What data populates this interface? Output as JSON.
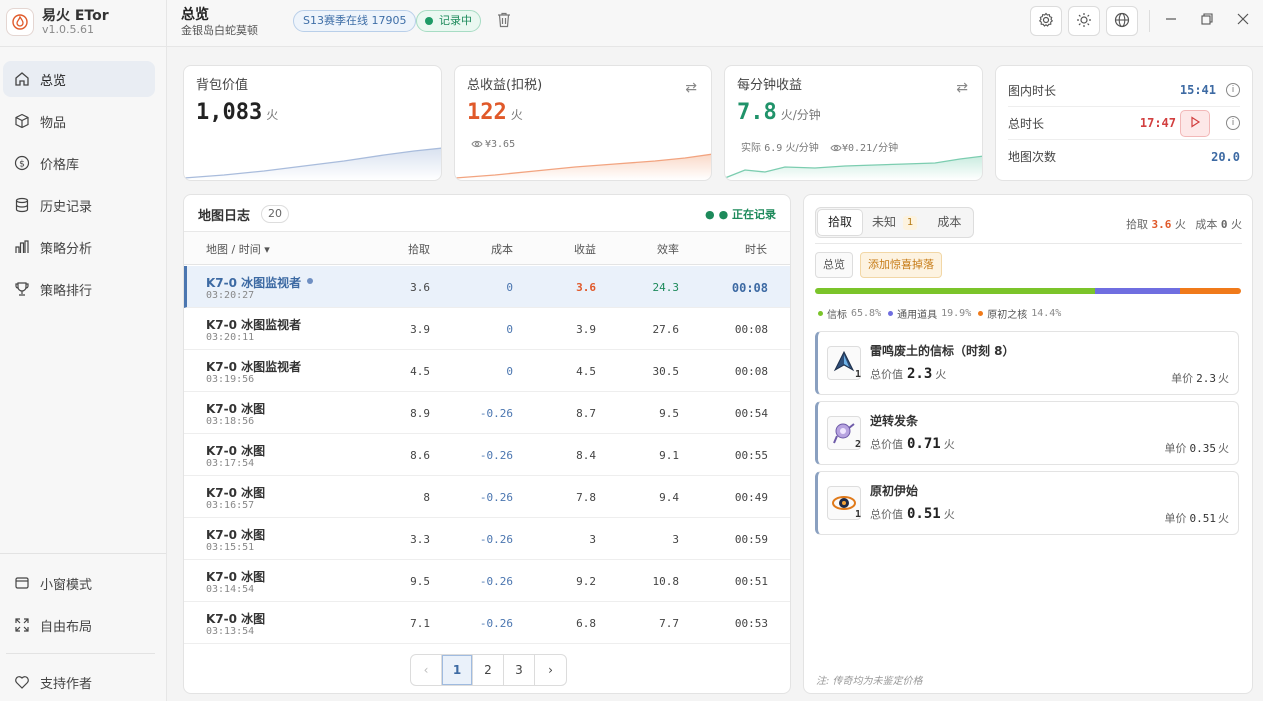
{
  "app": {
    "name": "易火 ETor",
    "version": "v1.0.5.61"
  },
  "sidebar": {
    "items": [
      {
        "label": "总览",
        "icon": "home-icon",
        "active": true
      },
      {
        "label": "物品",
        "icon": "cube-icon"
      },
      {
        "label": "价格库",
        "icon": "dollar-icon"
      },
      {
        "label": "历史记录",
        "icon": "database-icon"
      },
      {
        "label": "策略分析",
        "icon": "bar-chart-icon"
      },
      {
        "label": "策略排行",
        "icon": "trophy-icon"
      }
    ],
    "bottom": [
      {
        "label": "小窗模式",
        "icon": "window-icon"
      },
      {
        "label": "自由布局",
        "icon": "expand-icon"
      }
    ],
    "support": {
      "label": "支持作者",
      "icon": "heart-icon"
    }
  },
  "topbar": {
    "title": "总览",
    "subtitle": "金银岛白蛇莫顿",
    "season_badge": "S13赛季在线  17905",
    "recording_badge": "记录中"
  },
  "stats": {
    "backpack": {
      "label": "背包价值",
      "value": "1,083",
      "unit": "火"
    },
    "total_income": {
      "label": "总收益(扣税)",
      "value": "122",
      "unit": "火",
      "sub": "¥3.65"
    },
    "per_minute": {
      "label": "每分钟收益",
      "value": "7.8",
      "unit": "火/分钟",
      "actual_label": "实际",
      "actual_value": "6.9",
      "actual_unit": "火/分钟",
      "sub": "¥0.21/分钟"
    },
    "times": {
      "in_map_label": "图内时长",
      "in_map_value": "15:41",
      "total_label": "总时长",
      "total_value": "17:47",
      "count_label": "地图次数",
      "count_value": "20.0"
    }
  },
  "map_log": {
    "title": "地图日志",
    "count": "20",
    "live": "● 正在记录",
    "headers": {
      "name": "地图 / 时间 ▾",
      "pick": "拾取",
      "cost": "成本",
      "income": "收益",
      "eff": "效率",
      "dur": "时长"
    },
    "rows": [
      {
        "name": "K7-0 冰图监视者",
        "time": "03:20:27",
        "pick": "3.6",
        "cost": "0",
        "income": "3.6",
        "eff": "24.3",
        "dur": "00:08"
      },
      {
        "name": "K7-0 冰图监视者",
        "time": "03:20:11",
        "pick": "3.9",
        "cost": "0",
        "income": "3.9",
        "eff": "27.6",
        "dur": "00:08"
      },
      {
        "name": "K7-0 冰图监视者",
        "time": "03:19:56",
        "pick": "4.5",
        "cost": "0",
        "income": "4.5",
        "eff": "30.5",
        "dur": "00:08"
      },
      {
        "name": "K7-0 冰图",
        "time": "03:18:56",
        "pick": "8.9",
        "cost": "-0.26",
        "income": "8.7",
        "eff": "9.5",
        "dur": "00:54"
      },
      {
        "name": "K7-0 冰图",
        "time": "03:17:54",
        "pick": "8.6",
        "cost": "-0.26",
        "income": "8.4",
        "eff": "9.1",
        "dur": "00:55"
      },
      {
        "name": "K7-0 冰图",
        "time": "03:16:57",
        "pick": "8",
        "cost": "-0.26",
        "income": "7.8",
        "eff": "9.4",
        "dur": "00:49"
      },
      {
        "name": "K7-0 冰图",
        "time": "03:15:51",
        "pick": "3.3",
        "cost": "-0.26",
        "income": "3",
        "eff": "3",
        "dur": "00:59"
      },
      {
        "name": "K7-0 冰图",
        "time": "03:14:54",
        "pick": "9.5",
        "cost": "-0.26",
        "income": "9.2",
        "eff": "10.8",
        "dur": "00:51"
      },
      {
        "name": "K7-0 冰图",
        "time": "03:13:54",
        "pick": "7.1",
        "cost": "-0.26",
        "income": "6.8",
        "eff": "7.7",
        "dur": "00:53"
      }
    ],
    "pages": [
      "1",
      "2",
      "3"
    ],
    "current_page": "1"
  },
  "loot": {
    "tabs": {
      "pick": "拾取",
      "unknown": "未知",
      "unknown_count": "1",
      "cost": "成本"
    },
    "summary": {
      "pick_label": "拾取",
      "pick_value": "3.6",
      "cost_label": "成本",
      "cost_value": "0",
      "unit": "火"
    },
    "chips": {
      "overview": "总览",
      "add_drop": "添加惊喜掉落"
    },
    "breakdown": [
      {
        "name": "信标",
        "pct": 65.8,
        "pct_label": "65.8%",
        "color": "#7bc42a"
      },
      {
        "name": "通用道具",
        "pct": 19.9,
        "pct_label": "19.9%",
        "color": "#6f6ee0"
      },
      {
        "name": "原初之核",
        "pct": 14.4,
        "pct_label": "14.4%",
        "color": "#f07a1a"
      }
    ],
    "items": [
      {
        "name": "雷鸣废土的信标（时刻 8）",
        "qty": "1",
        "total_label": "总价值",
        "total": "2.3",
        "unit_label": "单价",
        "unit_price": "2.3",
        "currency": "火",
        "icon": "beacon-icon"
      },
      {
        "name": "逆转发条",
        "qty": "2",
        "total_label": "总价值",
        "total": "0.71",
        "unit_label": "单价",
        "unit_price": "0.35",
        "currency": "火",
        "icon": "clockwork-icon"
      },
      {
        "name": "原初伊始",
        "qty": "1",
        "total_label": "总价值",
        "total": "0.51",
        "unit_label": "单价",
        "unit_price": "0.51",
        "currency": "火",
        "icon": "primordial-icon"
      }
    ],
    "note": "注: 传奇均为未鉴定价格"
  }
}
